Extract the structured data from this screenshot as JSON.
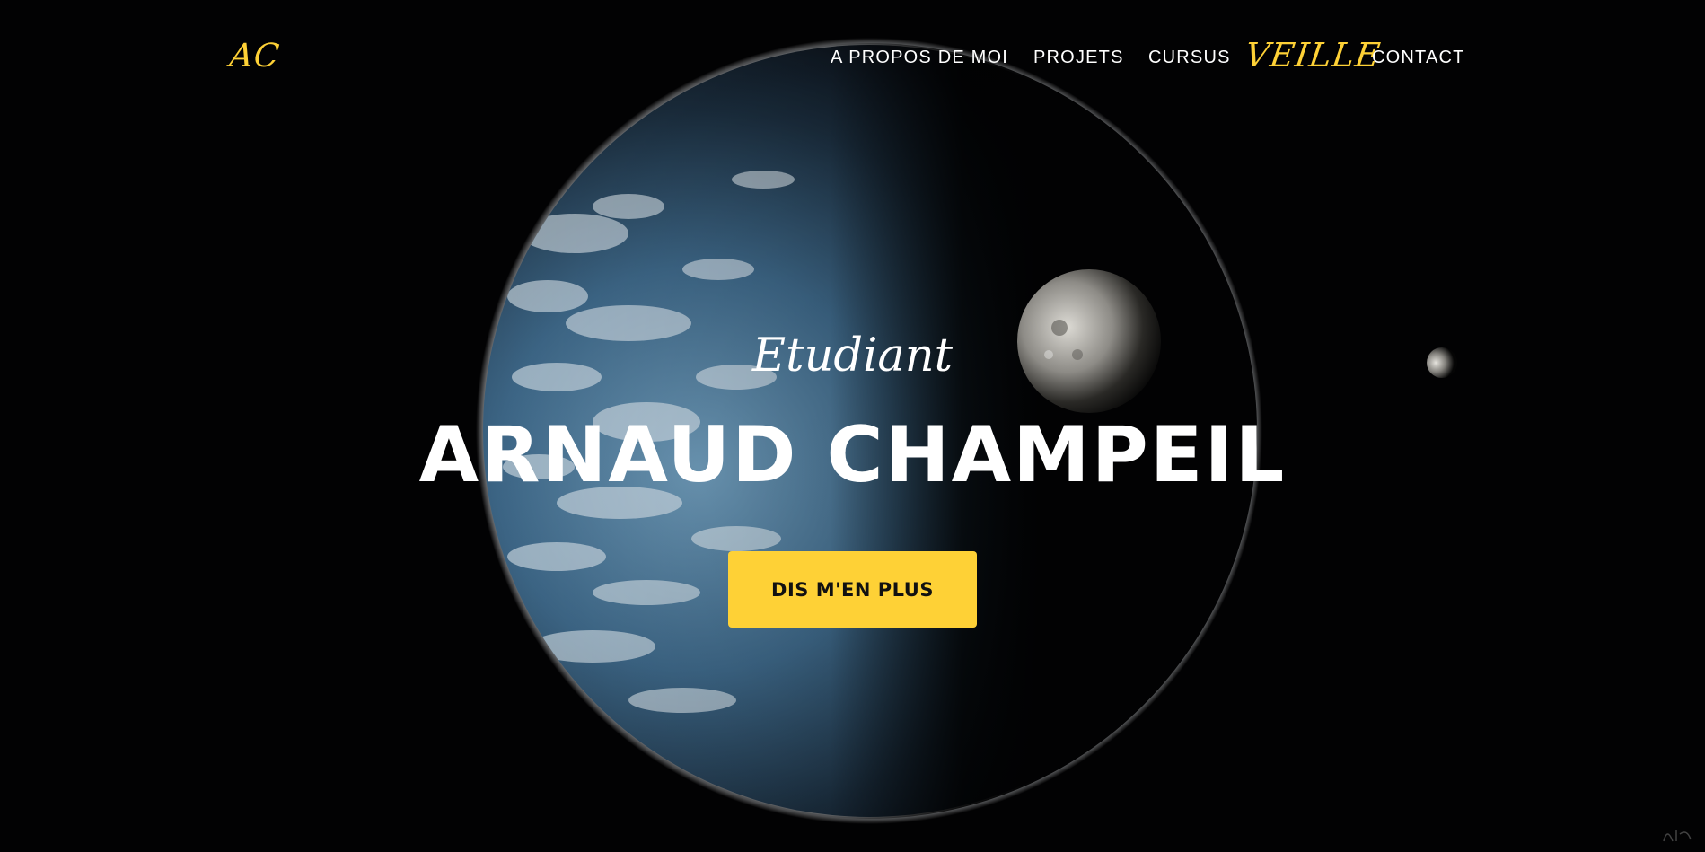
{
  "navbar": {
    "brand": "AC",
    "links": [
      {
        "label": "A PROPOS DE MOI"
      },
      {
        "label": "PROJETS"
      },
      {
        "label": "CURSUS"
      },
      {
        "label": "VEILLE"
      },
      {
        "label": "CONTACT"
      }
    ],
    "active_link": "VEILLE"
  },
  "hero": {
    "subheading": "Etudiant",
    "heading": "ARNAUD CHAMPEIL",
    "button_label": "DIS M'EN PLUS",
    "background": "space-earth-moon-image"
  },
  "colors": {
    "accent": "#fed136",
    "background": "#020203",
    "text": "#ffffff"
  }
}
